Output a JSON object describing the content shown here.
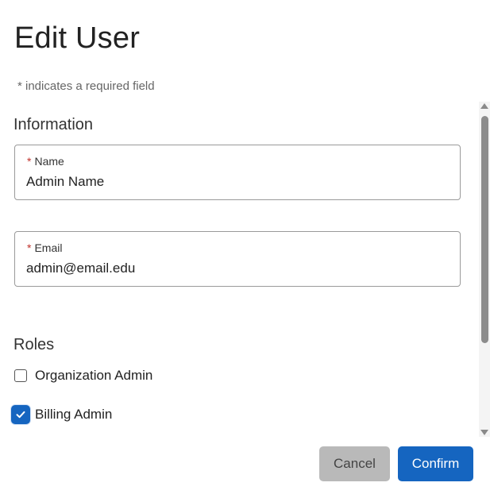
{
  "dialog": {
    "title": "Edit User",
    "required_note": "* indicates a required field"
  },
  "information": {
    "heading": "Information",
    "fields": [
      {
        "required_mark": "*",
        "label": "Name",
        "value": "Admin Name"
      },
      {
        "required_mark": "*",
        "label": "Email",
        "value": "admin@email.edu"
      }
    ]
  },
  "roles": {
    "heading": "Roles",
    "options": [
      {
        "label": "Organization Admin",
        "checked": false
      },
      {
        "label": "Billing Admin",
        "checked": true
      }
    ]
  },
  "footer": {
    "cancel_label": "Cancel",
    "confirm_label": "Confirm"
  },
  "colors": {
    "primary": "#1565c0",
    "required_star": "#c0312b",
    "cancel_bg": "#b9b9b9"
  }
}
